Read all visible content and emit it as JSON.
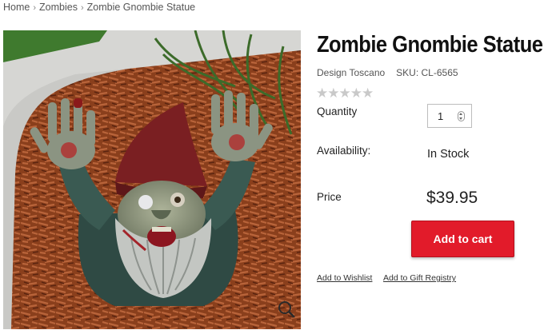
{
  "breadcrumb": {
    "items": [
      "Home",
      "Zombies",
      "Zombie Gnombie Statue"
    ],
    "separator": "›"
  },
  "product": {
    "title": "Zombie Gnombie Statue",
    "brand": "Design Toscano",
    "sku": "SKU: CL-6565",
    "rating_stars": "★★★★★",
    "rating_value": 0,
    "image_alt_icon": "zombie-gnome-statue-photo"
  },
  "purchase": {
    "quantity_label": "Quantity",
    "quantity_value": "1",
    "availability_label": "Availability:",
    "availability_value": "In Stock",
    "price_label": "Price",
    "price_value": "$39.95",
    "add_to_cart_label": "Add to cart"
  },
  "links": {
    "wishlist": "Add to Wishlist",
    "gift_registry": "Add to Gift Registry"
  },
  "colors": {
    "accent": "#e21b2a",
    "star_empty": "#c9c9c9"
  }
}
